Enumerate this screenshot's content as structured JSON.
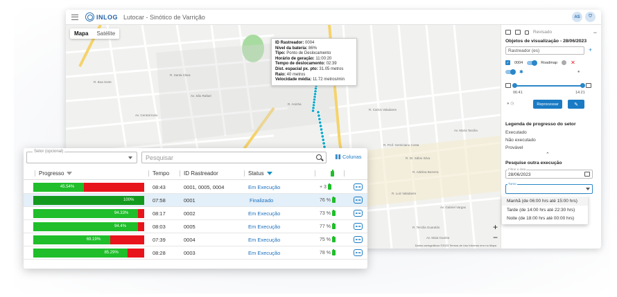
{
  "app": {
    "logo": "INLOG",
    "title": "Lutocar - Sinótico de Varrição",
    "avatars": [
      "AS",
      "⛉"
    ]
  },
  "map": {
    "toggle": [
      "Mapa",
      "Satélite"
    ],
    "tooltip": [
      {
        "label": "ID Rastreador:",
        "value": "0004"
      },
      {
        "label": "Nivel da bateria:",
        "value": "86%"
      },
      {
        "label": "Tipo:",
        "value": "Ponto de Deslocamento"
      },
      {
        "label": "Horário de geração:",
        "value": "11:00:20"
      },
      {
        "label": "Tempo de deslocamento:",
        "value": "02:39"
      },
      {
        "label": "Dist. espacial px. pto:",
        "value": "31.05 metros"
      },
      {
        "label": "Raio:",
        "value": "40 metros"
      },
      {
        "label": "Velocidade média:",
        "value": "11.72 metros/min"
      }
    ],
    "streets": [
      "R. Boa Sorte",
      "Av. Central Kalu",
      "R. Aninha",
      "R. Carlos Valadares",
      "R. Prof. Geminiano Costa",
      "R. Dr. Sábio Silva",
      "R. Adelina Bezerra",
      "Av. Gabriel Vargas",
      "R. Luiz Valadares",
      "R. Tercilia Guaraldo",
      "Av. Maria Tarcilia",
      "Av. Maia Guarita",
      "R. Santa Clara",
      "Av. São Rafael"
    ],
    "zoom_in": "+",
    "zoom_out": "−",
    "footer": "Dados cartográficos ©2023   Termos de Uso   Informar erro no Mapa"
  },
  "panel": {
    "revisado": "Revisado",
    "objetos_title": "Objetos de visualização - 28/06/2023",
    "rastreador_placeholder": "Rastreador (es)",
    "tracker_id": "0004",
    "roadmap": "Roadmap",
    "time_start": "06:41",
    "time_end": "14:21",
    "reprocessar": "Reprocessar",
    "legenda_title": "Legenda de progresso do setor",
    "legenda": [
      "Executado",
      "Não executado",
      "Provável"
    ],
    "pesquise_title": "Pesquise outra execução",
    "date_label": "Filtrar a data",
    "date_value": "28/06/2023",
    "turno_label": "Turno",
    "turnos": [
      "Manhã (de 06:00 hrs até 15:00 hrs)",
      "Tarde (de 14:00 hrs até 22:30 hrs)",
      "Noite (de 18:00 hrs até 00:00 hrs)"
    ]
  },
  "table": {
    "setor_label": "Setor (opcional)",
    "search_placeholder": "Pesquisar",
    "colunas": "Colunas",
    "headers": {
      "progresso": "Progresso",
      "tempo": "Tempo",
      "id": "ID Rastreador",
      "status": "Status"
    },
    "rows": [
      {
        "progress": 45.54,
        "label": "45.54%",
        "tempo": "08:43",
        "id": "0001, 0005, 0004",
        "status": "Em Execução",
        "batt": "+ 3"
      },
      {
        "progress": 100,
        "label": "100%",
        "tempo": "07:58",
        "id": "0001",
        "status": "Finalizado",
        "batt": "76 %"
      },
      {
        "progress": 94.33,
        "label": "94.33%",
        "tempo": "08:17",
        "id": "0002",
        "status": "Em Execução",
        "batt": "73 %"
      },
      {
        "progress": 94.4,
        "label": "94.4%",
        "tempo": "08:03",
        "id": "0005",
        "status": "Em Execução",
        "batt": "77 %"
      },
      {
        "progress": 69.19,
        "label": "69.19%",
        "tempo": "07:39",
        "id": "0004",
        "status": "Em Execução",
        "batt": "75 %"
      },
      {
        "progress": 85.29,
        "label": "85.29%",
        "tempo": "08:28",
        "id": "0003",
        "status": "Em Execução",
        "batt": "78 %"
      }
    ]
  },
  "colors": {
    "accent": "#1a7bc4",
    "progress_green": "#1fbe2a",
    "progress_red": "#e8141c",
    "done_green": "#139a1e",
    "route_cyan": "#12a9c9"
  }
}
